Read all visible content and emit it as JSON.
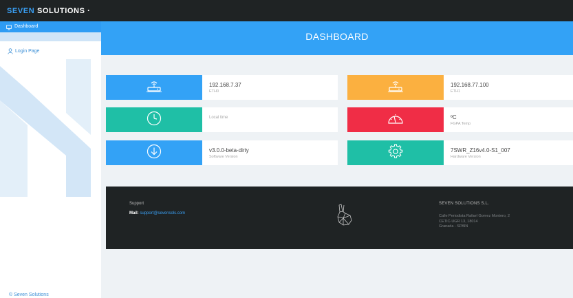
{
  "header": {
    "brand_accent": "SEVEN",
    "brand_rest": " SOLUTIONS ·"
  },
  "sidebar": {
    "items": [
      {
        "label": "Dashboard",
        "icon": "monitor-icon",
        "active": true
      },
      {
        "label": "Login Page",
        "icon": "user-icon",
        "active": false
      }
    ],
    "footer": "© Seven Solutions"
  },
  "banner": {
    "title": "DASHBOARD"
  },
  "cards": {
    "eth0": {
      "value": "192.168.7.37",
      "label": "ETH0",
      "icon": "router-icon",
      "color": "#33a2f6"
    },
    "eth1": {
      "value": "192.168.77.100",
      "label": "ETH1",
      "icon": "router-icon",
      "color": "#fbb040"
    },
    "local_time": {
      "value": "",
      "label": "Local time",
      "icon": "clock-icon",
      "color": "#1fbfa6"
    },
    "fpga_temp": {
      "value": "ºC",
      "label": "FGPA Temp",
      "icon": "gauge-icon",
      "color": "#f02d46"
    },
    "software": {
      "value": "v3.0.0-beta-dirty",
      "label": "Software Version",
      "icon": "download-icon",
      "color": "#33a2f6"
    },
    "hardware": {
      "value": "7SWR_Z16v4.0-S1_007",
      "label": "Hardware Version",
      "icon": "gear-icon",
      "color": "#1fbfa6"
    }
  },
  "footer": {
    "support_title": "Support",
    "mail_label": "Mail:",
    "mail_value": "support@sevensols.com",
    "company": "SEVEN SOLUTIONS S.L.",
    "address_line1": "Calle Periodista Rafael Gomez Montero, 2",
    "address_line2": "CETIC-UGR 13, 18014",
    "address_line3": "Granada - SPAIN"
  }
}
